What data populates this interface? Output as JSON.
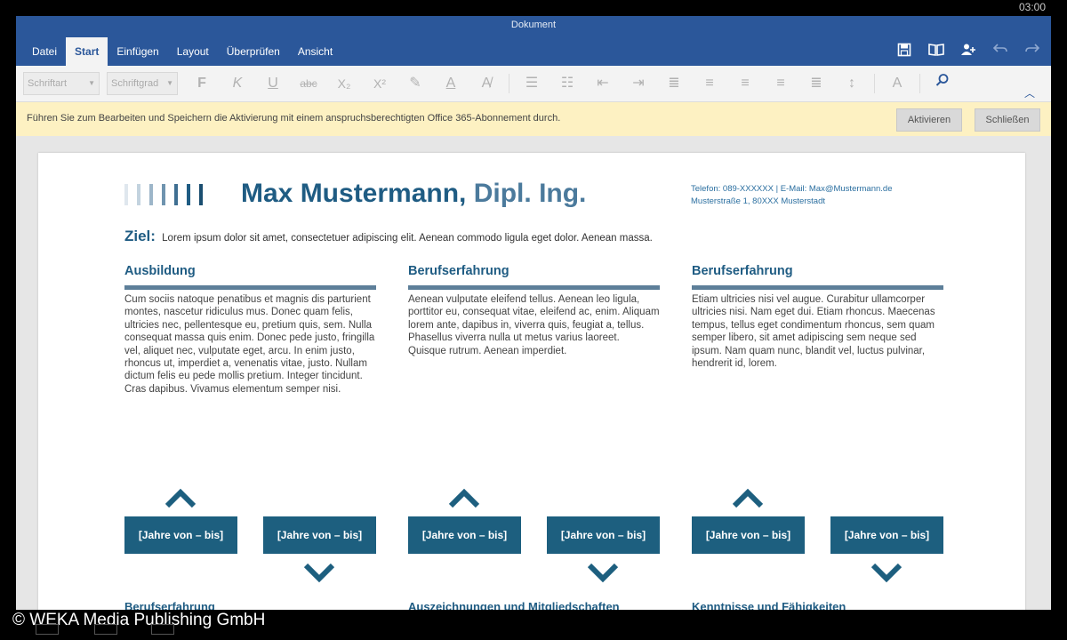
{
  "status": {
    "time": "03:00"
  },
  "app": {
    "doc_title": "Dokument",
    "tabs": [
      "Datei",
      "Start",
      "Einfügen",
      "Layout",
      "Überprüfen",
      "Ansicht"
    ],
    "active_tab": "Start",
    "title_actions": [
      "save-icon",
      "read-mode-icon",
      "share-icon",
      "undo-icon",
      "redo-icon"
    ]
  },
  "toolbar": {
    "font_placeholder": "Schriftart",
    "size_placeholder": "Schriftgrad",
    "bold": "F",
    "italic": "K",
    "underline": "U",
    "strike": "abc",
    "subscript": "X₂",
    "superscript": "X²"
  },
  "notice": {
    "message": "Führen Sie zum Bearbeiten und Speichern die Aktivierung mit einem anspruchsberechtigten Office 365-Abonnement durch.",
    "activate_label": "Aktivieren",
    "close_label": "Schließen"
  },
  "document": {
    "name_main": "Max Mustermann,",
    "name_degree": "Dipl. Ing.",
    "contact_line1": "Telefon: 089-XXXXXX | E-Mail: Max@Mustermann.de",
    "contact_line2": "Musterstraße 1, 80XXX Musterstadt",
    "goal_label": "Ziel:",
    "goal_text": "Lorem ipsum dolor sit amet, consectetuer adipiscing elit. Aenean commodo ligula eget dolor. Aenean massa.",
    "columns": [
      {
        "heading": "Ausbildung",
        "text": "Cum sociis natoque penatibus et magnis dis parturient montes, nascetur ridiculus mus. Donec quam felis, ultricies nec, pellentesque eu, pretium quis, sem. Nulla consequat massa quis enim. Donec pede justo, fringilla vel, aliquet nec, vulputate eget, arcu. In enim justo, rhoncus ut, imperdiet a, venenatis vitae, justo. Nullam dictum felis eu pede mollis pretium. Integer tincidunt. Cras dapibus. Vivamus elementum semper nisi."
      },
      {
        "heading": "Berufserfahrung",
        "text": "Aenean vulputate eleifend tellus. Aenean leo ligula, porttitor eu, consequat vitae, eleifend ac, enim. Aliquam lorem ante, dapibus in, viverra quis, feugiat a, tellus. Phasellus viverra nulla ut metus varius laoreet. Quisque rutrum. Aenean imperdiet."
      },
      {
        "heading": "Berufserfahrung",
        "text": "Etiam ultricies nisi vel augue. Curabitur ullamcorper ultricies nisi. Nam eget dui. Etiam rhoncus. Maecenas tempus, tellus eget condimentum rhoncus, sem quam semper libero, sit amet adipiscing sem neque sed ipsum. Nam quam nunc, blandit vel, luctus pulvinar, hendrerit id, lorem."
      }
    ],
    "year_label": "[Jahre von – bis]",
    "bottom_headings": [
      "Berufserfahrung",
      "Auszeichnungen und Mitgliedschaften",
      "Kenntnisse und Fähigkeiten"
    ]
  },
  "colors": {
    "ribbon": "#2b579a",
    "accent": "#1f5c83",
    "box": "#1d5f7f",
    "notice_bg": "#fdf1c2"
  },
  "watermark": "© WEKA Media Publishing GmbH"
}
